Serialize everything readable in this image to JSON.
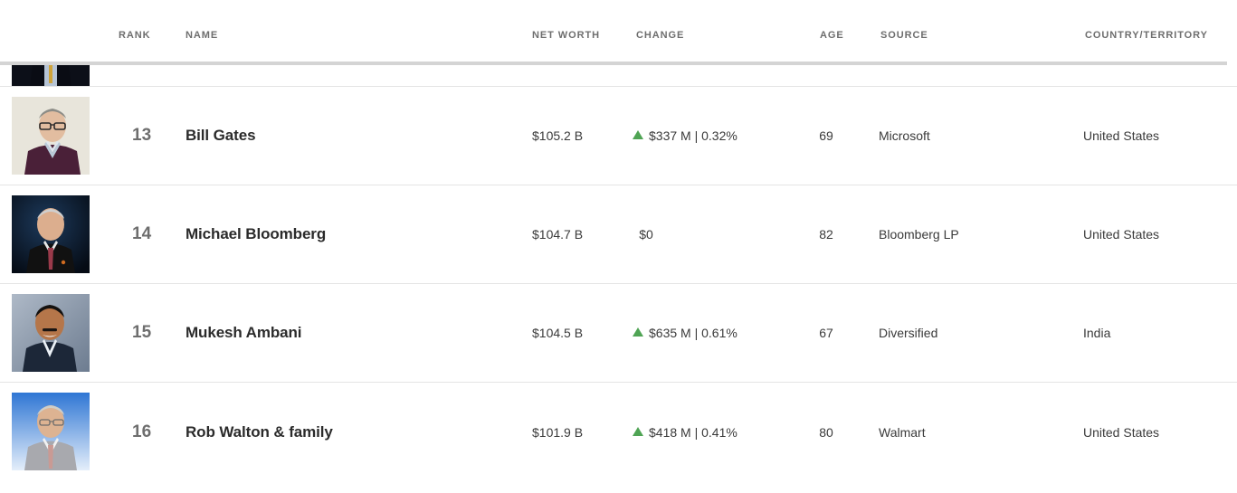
{
  "colors": {
    "accent_green": "#4fa454",
    "header_text": "#6e6e6e",
    "name_text": "#2b2b2b",
    "body_text": "#3a3a3a",
    "rule": "#d4d4d4",
    "row_divider": "#e4e4e4",
    "background": "#ffffff"
  },
  "table": {
    "columns": [
      {
        "key": "rank",
        "label": "RANK"
      },
      {
        "key": "name",
        "label": "NAME"
      },
      {
        "key": "worth",
        "label": "NET WORTH"
      },
      {
        "key": "change",
        "label": "CHANGE"
      },
      {
        "key": "age",
        "label": "AGE"
      },
      {
        "key": "source",
        "label": "SOURCE"
      },
      {
        "key": "country",
        "label": "COUNTRY/TERRITORY"
      }
    ],
    "rows": [
      {
        "rank": "",
        "name": "",
        "worth": "",
        "change": "",
        "change_direction": "none",
        "age": "",
        "source": "",
        "country": "",
        "clipped": true,
        "portrait": {
          "bg": "#0c0f18",
          "suit": "#0a0c14",
          "shirt": "#b6c4d6",
          "skin": "#d8b79a",
          "accent": "#cfa33a"
        }
      },
      {
        "rank": "13",
        "name": "Bill Gates",
        "worth": "$105.2 B",
        "change": "$337 M | 0.32%",
        "change_direction": "up",
        "age": "69",
        "source": "Microsoft",
        "country": "United States",
        "clipped": false,
        "portrait": {
          "bg": "#e8e5db",
          "suit": "#4a2038",
          "shirt": "#b9c9d8",
          "skin": "#e2bda0",
          "hair": "#8c8c86",
          "glasses": "#2b2b2b"
        }
      },
      {
        "rank": "14",
        "name": "Michael Bloomberg",
        "worth": "$104.7 B",
        "change": "$0",
        "change_direction": "none",
        "age": "82",
        "source": "Bloomberg LP",
        "country": "United States",
        "clipped": false,
        "portrait": {
          "bg": "#0b1a2e",
          "suit": "#111111",
          "shirt": "#e8e8e8",
          "skin": "#dcae8e",
          "hair": "#cfcfcf",
          "tie": "#9a3a4a"
        }
      },
      {
        "rank": "15",
        "name": "Mukesh Ambani",
        "worth": "$104.5 B",
        "change": "$635 M | 0.61%",
        "change_direction": "up",
        "age": "67",
        "source": "Diversified",
        "country": "India",
        "clipped": false,
        "portrait": {
          "bg": "#8a98ab",
          "suit": "#1c2738",
          "shirt": "#eaf0f6",
          "skin": "#b5764a",
          "hair": "#14110f",
          "mustache": "#1a1513"
        }
      },
      {
        "rank": "16",
        "name": "Rob Walton & family",
        "worth": "$101.9 B",
        "change": "$418 M | 0.41%",
        "change_direction": "up",
        "age": "80",
        "source": "Walmart",
        "country": "United States",
        "clipped": false,
        "portrait": {
          "bg": "#3f82d8",
          "bg2": "#dfeaf7",
          "suit": "#a8a9ae",
          "shirt": "#f2f2f2",
          "skin": "#ddb392",
          "hair": "#cfcec8",
          "tie": "#c99a94"
        }
      }
    ]
  }
}
